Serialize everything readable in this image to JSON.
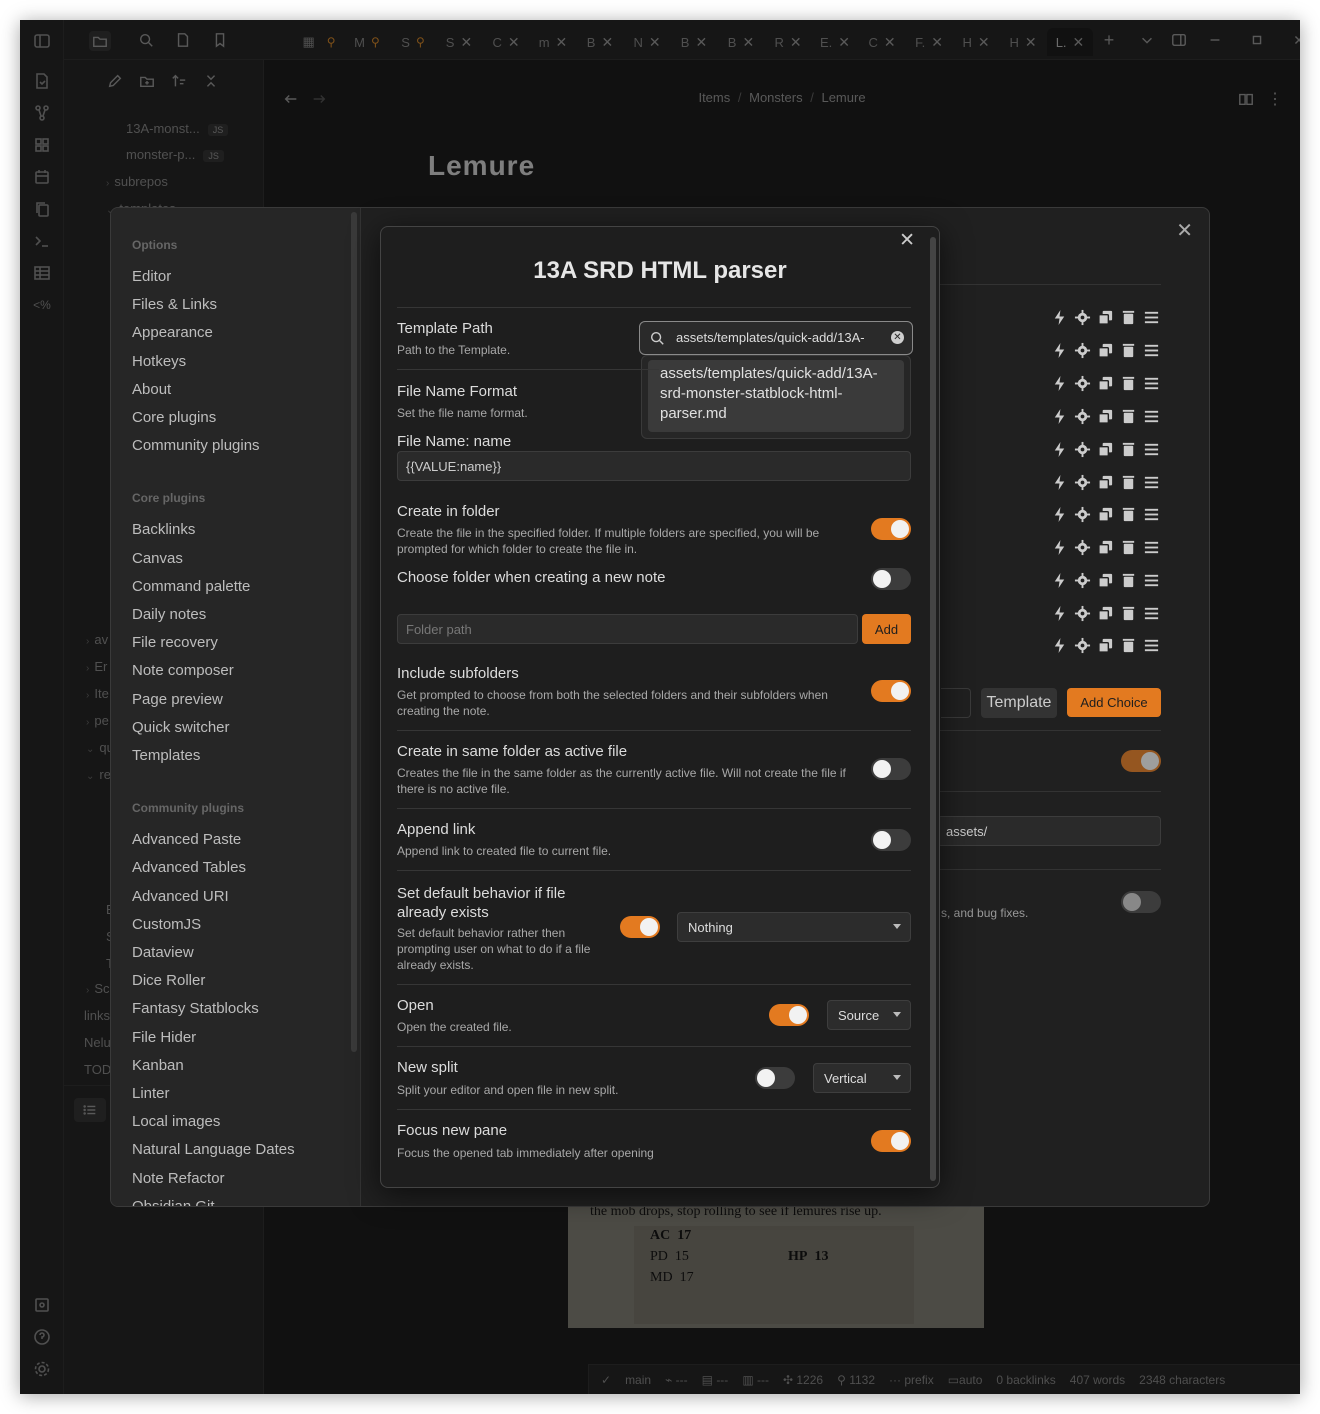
{
  "tabs": [
    {
      "label": "",
      "pinned": true
    },
    {
      "label": "M",
      "pinned": true
    },
    {
      "label": "S",
      "pinned": true
    },
    {
      "label": "S",
      "pinned": false
    },
    {
      "label": "C",
      "pinned": false
    },
    {
      "label": "m",
      "pinned": false
    },
    {
      "label": "B",
      "pinned": false
    },
    {
      "label": "N",
      "pinned": false
    },
    {
      "label": "B",
      "pinned": false
    },
    {
      "label": "B",
      "pinned": false
    },
    {
      "label": "R",
      "pinned": false
    },
    {
      "label": "E.",
      "pinned": false
    },
    {
      "label": "C",
      "pinned": false
    },
    {
      "label": "F.",
      "pinned": false
    },
    {
      "label": "H",
      "pinned": false
    },
    {
      "label": "H",
      "pinned": false
    },
    {
      "label": "L.",
      "pinned": false
    }
  ],
  "explorer": {
    "items": [
      {
        "label": "13A-monst...",
        "badge": "JS"
      },
      {
        "label": "monster-p...",
        "badge": "JS"
      },
      {
        "label": "subrepos"
      },
      {
        "label": "templates"
      }
    ],
    "partial": [
      "av",
      "Er",
      "Ite",
      "pe",
      "qu",
      "re",
      "E",
      "S",
      "T",
      "Sc",
      "links",
      "Nelu",
      "TOD"
    ]
  },
  "editor": {
    "breadcrumb": [
      "Items",
      "Monsters",
      "Lemure"
    ],
    "title": "Lemure",
    "hr_text": "---",
    "statblock": {
      "text": "the mob drops, stop rolling to see if lemures rise up.",
      "ac_label": "AC",
      "ac": "17",
      "pd_label": "PD",
      "pd": "15",
      "md_label": "MD",
      "md": "17",
      "hp_label": "HP",
      "hp": "13"
    }
  },
  "statusbar": {
    "branch": "main",
    "a": "---",
    "b": "---",
    "c": "---",
    "n1": "1226",
    "n2": "1132",
    "prefix": "prefix",
    "auto": "auto",
    "backlinks": "0 backlinks",
    "words": "407 words",
    "characters": "2348 characters"
  },
  "settings": {
    "options_head": "Options",
    "options": [
      "Editor",
      "Files & Links",
      "Appearance",
      "Hotkeys",
      "About",
      "Core plugins",
      "Community plugins"
    ],
    "core_head": "Core plugins",
    "core": [
      "Backlinks",
      "Canvas",
      "Command palette",
      "Daily notes",
      "File recovery",
      "Note composer",
      "Page preview",
      "Quick switcher",
      "Templates"
    ],
    "community_head": "Community plugins",
    "community": [
      "Advanced Paste",
      "Advanced Tables",
      "Advanced URI",
      "CustomJS",
      "Dataview",
      "Dice Roller",
      "Fantasy Statblocks",
      "File Hider",
      "Kanban",
      "Linter",
      "Local images",
      "Natural Language Dates",
      "Note Refactor",
      "Obsidian Git"
    ],
    "template_btn": "Template",
    "add_choice_btn": "Add Choice",
    "assets_value": "assets/",
    "bugfix_text": "s, and bug fixes."
  },
  "modal": {
    "title": "13A SRD HTML parser",
    "template_path": {
      "name": "Template Path",
      "desc": "Path to the Template.",
      "value": "assets/templates/quick-add/13A-",
      "suggestion": "assets/templates/quick-add/13A-srd-monster-statblock-html-parser.md"
    },
    "file_name_format": {
      "name": "File Name Format",
      "desc": "Set the file name format."
    },
    "file_name": {
      "name": "File Name: name",
      "value": "{{VALUE:name}}"
    },
    "create_in_folder": {
      "name": "Create in folder",
      "desc": "Create the file in the specified folder. If multiple folders are specified, you will be prompted for which folder to create the file in."
    },
    "choose_folder": {
      "name": "Choose folder when creating a new note"
    },
    "folder_path": {
      "placeholder": "Folder path",
      "add": "Add"
    },
    "include_subfolders": {
      "name": "Include subfolders",
      "desc": "Get prompted to choose from both the selected folders and their subfolders when creating the note."
    },
    "same_folder": {
      "name": "Create in same folder as active file",
      "desc": "Creates the file in the same folder as the currently active file. Will not create the file if there is no active file."
    },
    "append_link": {
      "name": "Append link",
      "desc": "Append link to created file to current file."
    },
    "default_behavior": {
      "name": "Set default behavior if file already exists",
      "desc": "Set default behavior rather then prompting user on what to do if a file already exists.",
      "value": "Nothing"
    },
    "open": {
      "name": "Open",
      "desc": "Open the created file.",
      "value": "Source"
    },
    "new_split": {
      "name": "New split",
      "desc": "Split your editor and open file in new split.",
      "value": "Vertical"
    },
    "focus_pane": {
      "name": "Focus new pane",
      "desc": "Focus the opened tab immediately after opening"
    }
  },
  "colors": {
    "accent": "#e37a20",
    "bg": "#1e1e1e",
    "panel": "#262626"
  }
}
